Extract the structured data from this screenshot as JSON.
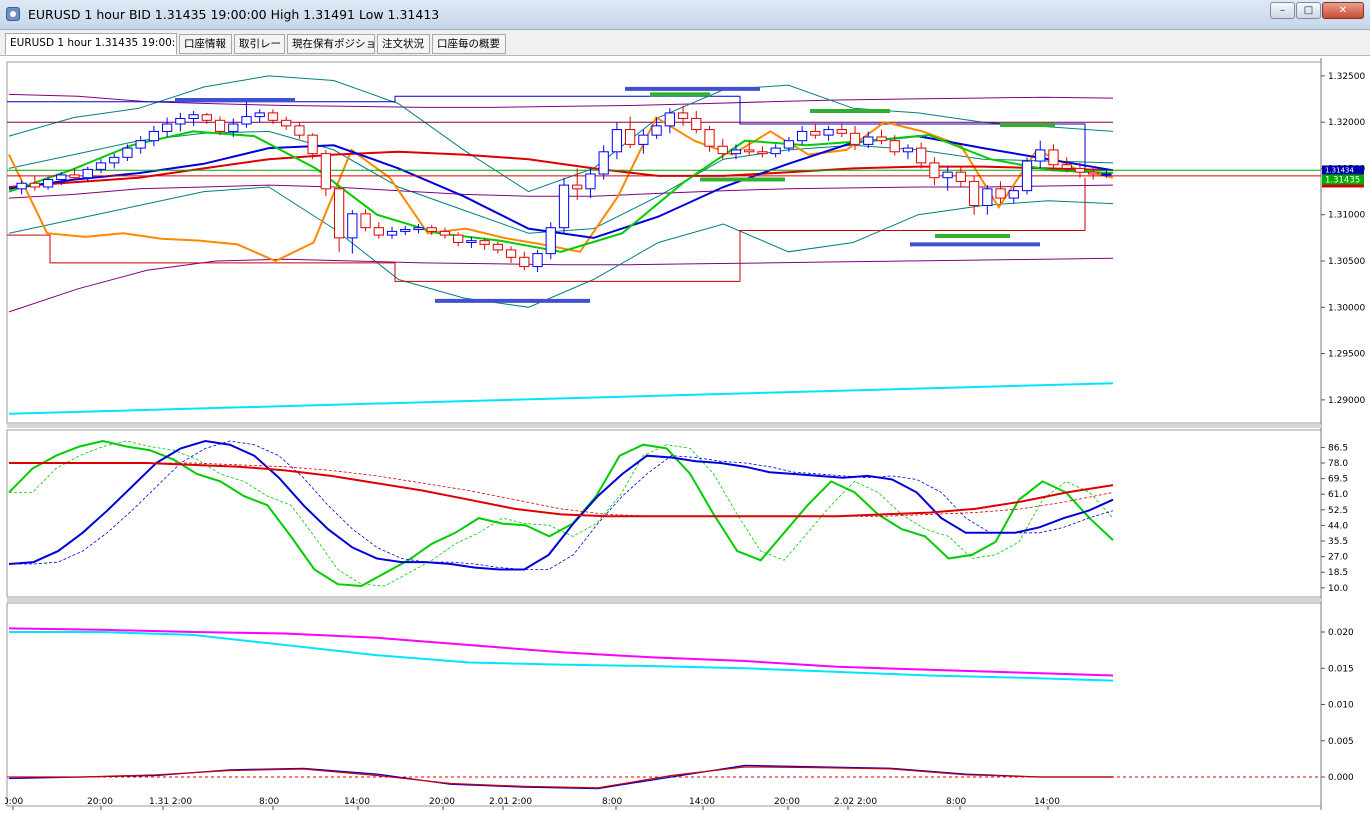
{
  "window": {
    "title": "EURUSD 1 hour BID 1.31435 19:00:00 High 1.31491 Low 1.31413",
    "buttons": {
      "minimize": "–",
      "maximize": "□",
      "close": "✕"
    }
  },
  "tabs": [
    {
      "label": "EURUSD 1 hour 1.31435 19:00:00",
      "active": true
    },
    {
      "label": "口座情報"
    },
    {
      "label": "取引レート"
    },
    {
      "label": "現在保有ポジション"
    },
    {
      "label": "注文状況"
    },
    {
      "label": "口座毎の概要"
    }
  ],
  "colors": {
    "background": "#ffffff",
    "candle_up": "#0000ff",
    "candle_down": "#e00000",
    "ma_fast": "#00cc00",
    "ma_mid": "#0000dd",
    "ma_slow": "#dd0000",
    "orange": "#ff8800",
    "cyan": "#00e5ff",
    "magenta": "#ff00ff",
    "teal": "#008080",
    "purple": "#800080"
  },
  "price_labels": {
    "current": "1.31435",
    "current_small": "1.31434"
  },
  "chart_data": [
    {
      "type": "candlestick",
      "panel": "price",
      "symbol": "EURUSD",
      "timeframe": "1 hour",
      "y_ticks": [
        1.325,
        1.32,
        1.315,
        1.31,
        1.305,
        1.3,
        1.295,
        1.29
      ],
      "y_tick_labels": [
        "1.32500",
        "1.32000",
        "1.31500",
        "1.31000",
        "1.30500",
        "1.30000",
        "1.29500",
        "1.29000"
      ],
      "ylim": [
        1.2875,
        1.3265
      ],
      "x_tick_labels": [
        "0:00",
        "20:00",
        "1.31  2:00",
        "8:00",
        "14:00",
        "20:00",
        "2.01  2:00",
        "8:00",
        "14:00",
        "20:00",
        "2.02  2:00",
        "8:00",
        "14:00"
      ],
      "current_price": 1.31435,
      "high": 1.31491,
      "low": 1.31413,
      "candles": [
        [
          1.3128,
          1.3137,
          1.3122,
          1.3134
        ],
        [
          1.3134,
          1.3142,
          1.3126,
          1.313
        ],
        [
          1.313,
          1.3141,
          1.3127,
          1.3138
        ],
        [
          1.3138,
          1.3146,
          1.3132,
          1.3143
        ],
        [
          1.3143,
          1.315,
          1.3138,
          1.314
        ],
        [
          1.314,
          1.3152,
          1.3136,
          1.3149
        ],
        [
          1.3149,
          1.316,
          1.3145,
          1.3156
        ],
        [
          1.3156,
          1.3166,
          1.315,
          1.3162
        ],
        [
          1.3162,
          1.3176,
          1.3158,
          1.3172
        ],
        [
          1.3172,
          1.3185,
          1.3166,
          1.318
        ],
        [
          1.318,
          1.3196,
          1.3174,
          1.319
        ],
        [
          1.319,
          1.3205,
          1.3184,
          1.3198
        ],
        [
          1.3198,
          1.321,
          1.319,
          1.3204
        ],
        [
          1.3204,
          1.3212,
          1.3196,
          1.3208
        ],
        [
          1.3208,
          1.321,
          1.3198,
          1.3202
        ],
        [
          1.3202,
          1.3206,
          1.3186,
          1.319
        ],
        [
          1.319,
          1.3204,
          1.3184,
          1.3198
        ],
        [
          1.3198,
          1.3222,
          1.3194,
          1.3206
        ],
        [
          1.3206,
          1.3214,
          1.32,
          1.321
        ],
        [
          1.321,
          1.3214,
          1.3198,
          1.3202
        ],
        [
          1.3202,
          1.3206,
          1.3192,
          1.3196
        ],
        [
          1.3196,
          1.32,
          1.3182,
          1.3186
        ],
        [
          1.3186,
          1.3188,
          1.316,
          1.3166
        ],
        [
          1.3166,
          1.317,
          1.312,
          1.3128
        ],
        [
          1.3128,
          1.313,
          1.306,
          1.3075
        ],
        [
          1.3075,
          1.3105,
          1.3058,
          1.3101
        ],
        [
          1.3101,
          1.3106,
          1.3082,
          1.3086
        ],
        [
          1.3086,
          1.3092,
          1.3074,
          1.3078
        ],
        [
          1.3078,
          1.3087,
          1.3074,
          1.3082
        ],
        [
          1.3082,
          1.3088,
          1.3078,
          1.3084
        ],
        [
          1.3084,
          1.309,
          1.308,
          1.3086
        ],
        [
          1.3086,
          1.3089,
          1.3078,
          1.3082
        ],
        [
          1.3082,
          1.3086,
          1.3074,
          1.3078
        ],
        [
          1.3078,
          1.3081,
          1.3066,
          1.307
        ],
        [
          1.307,
          1.3076,
          1.3064,
          1.3072
        ],
        [
          1.3072,
          1.3075,
          1.3062,
          1.3068
        ],
        [
          1.3068,
          1.3071,
          1.3058,
          1.3062
        ],
        [
          1.3062,
          1.3066,
          1.3048,
          1.3054
        ],
        [
          1.3054,
          1.306,
          1.304,
          1.3044
        ],
        [
          1.3044,
          1.3062,
          1.3038,
          1.3058
        ],
        [
          1.3058,
          1.3092,
          1.3052,
          1.3086
        ],
        [
          1.3086,
          1.314,
          1.308,
          1.3132
        ],
        [
          1.3132,
          1.315,
          1.3116,
          1.3128
        ],
        [
          1.3128,
          1.315,
          1.3118,
          1.3144
        ],
        [
          1.3144,
          1.3175,
          1.3138,
          1.3168
        ],
        [
          1.3168,
          1.32,
          1.316,
          1.3192
        ],
        [
          1.3192,
          1.3206,
          1.3172,
          1.3176
        ],
        [
          1.3176,
          1.3192,
          1.3166,
          1.3186
        ],
        [
          1.3186,
          1.3205,
          1.3182,
          1.3196
        ],
        [
          1.3196,
          1.3215,
          1.3188,
          1.321
        ],
        [
          1.321,
          1.3218,
          1.3196,
          1.3204
        ],
        [
          1.3204,
          1.3212,
          1.3188,
          1.3192
        ],
        [
          1.3192,
          1.3196,
          1.3168,
          1.3174
        ],
        [
          1.3174,
          1.3182,
          1.316,
          1.3166
        ],
        [
          1.3166,
          1.3176,
          1.316,
          1.317
        ],
        [
          1.317,
          1.3179,
          1.3164,
          1.3168
        ],
        [
          1.3168,
          1.3174,
          1.3162,
          1.3166
        ],
        [
          1.3166,
          1.3176,
          1.3162,
          1.3172
        ],
        [
          1.3172,
          1.3184,
          1.3168,
          1.318
        ],
        [
          1.318,
          1.3196,
          1.3176,
          1.319
        ],
        [
          1.319,
          1.3198,
          1.3182,
          1.3186
        ],
        [
          1.3186,
          1.3196,
          1.318,
          1.3192
        ],
        [
          1.3192,
          1.3198,
          1.3184,
          1.3188
        ],
        [
          1.3188,
          1.3196,
          1.317,
          1.3176
        ],
        [
          1.3176,
          1.319,
          1.3172,
          1.3184
        ],
        [
          1.3184,
          1.3192,
          1.3176,
          1.318
        ],
        [
          1.318,
          1.3186,
          1.3164,
          1.3168
        ],
        [
          1.3168,
          1.3176,
          1.316,
          1.3172
        ],
        [
          1.3172,
          1.3178,
          1.315,
          1.3156
        ],
        [
          1.3156,
          1.3162,
          1.3132,
          1.314
        ],
        [
          1.314,
          1.3152,
          1.3126,
          1.3146
        ],
        [
          1.3146,
          1.3152,
          1.313,
          1.3136
        ],
        [
          1.3136,
          1.3142,
          1.31,
          1.311
        ],
        [
          1.311,
          1.3132,
          1.31,
          1.3128
        ],
        [
          1.3128,
          1.3136,
          1.3112,
          1.3118
        ],
        [
          1.3118,
          1.313,
          1.3112,
          1.3126
        ],
        [
          1.3126,
          1.3162,
          1.3122,
          1.3158
        ],
        [
          1.3158,
          1.318,
          1.315,
          1.317
        ],
        [
          1.317,
          1.3176,
          1.315,
          1.3154
        ],
        [
          1.3154,
          1.3162,
          1.3146,
          1.315
        ],
        [
          1.315,
          1.3156,
          1.314,
          1.3146
        ],
        [
          1.3146,
          1.3152,
          1.3138,
          1.3144
        ],
        [
          1.3144,
          1.315,
          1.314,
          1.3144
        ]
      ]
    },
    {
      "type": "line",
      "panel": "oscillator",
      "y_ticks": [
        10.0,
        18.5,
        27.0,
        35.5,
        44.0,
        52.5,
        61.0,
        69.5,
        78.0,
        86.5
      ],
      "y_tick_labels": [
        "10.0",
        "18.5",
        "27.0",
        "35.5",
        "44.0",
        "52.5",
        "61.0",
        "69.5",
        "78.0",
        "86.5"
      ],
      "ylim": [
        5,
        96
      ],
      "series": [
        {
          "color": "green",
          "values": [
            62,
            75,
            82,
            87,
            90,
            87,
            85,
            80,
            72,
            68,
            60,
            55,
            38,
            20,
            12,
            11,
            18,
            25,
            34,
            40,
            48,
            45,
            44,
            38,
            45,
            60,
            82,
            88,
            86,
            72,
            50,
            30,
            25,
            40,
            55,
            68,
            62,
            50,
            42,
            38,
            26,
            28,
            35,
            58,
            68,
            62,
            48,
            36
          ]
        },
        {
          "color": "blue",
          "values": [
            23,
            24,
            30,
            40,
            52,
            65,
            78,
            86,
            90,
            88,
            82,
            70,
            55,
            42,
            32,
            26,
            24,
            24,
            23,
            21,
            20,
            20,
            28,
            45,
            60,
            72,
            82,
            81,
            79,
            78,
            76,
            73,
            72,
            71,
            70,
            71,
            69,
            62,
            48,
            40,
            40,
            40,
            43,
            48,
            52,
            58
          ]
        },
        {
          "color": "red",
          "values": [
            78,
            78,
            78,
            78,
            77,
            76,
            74,
            71,
            67,
            63,
            58,
            53,
            50,
            49,
            49,
            49,
            49,
            49,
            49,
            50,
            51,
            53,
            57,
            62,
            66
          ]
        }
      ]
    },
    {
      "type": "line",
      "panel": "lower",
      "y_ticks": [
        0.0,
        0.005,
        0.01,
        0.015,
        0.02
      ],
      "y_tick_labels": [
        "0.000",
        "0.005",
        "0.010",
        "0.015",
        "0.020"
      ],
      "ylim": [
        -0.004,
        0.024
      ],
      "series": [
        {
          "color": "magenta",
          "values": [
            0.0205,
            0.0203,
            0.02,
            0.0198,
            0.0192,
            0.0182,
            0.0172,
            0.0165,
            0.016,
            0.0152,
            0.0148,
            0.0144,
            0.014
          ]
        },
        {
          "color": "cyan",
          "values": [
            0.02,
            0.02,
            0.0196,
            0.0182,
            0.0168,
            0.0158,
            0.0155,
            0.0153,
            0.015,
            0.0145,
            0.014,
            0.0137,
            0.0133
          ]
        }
      ]
    }
  ]
}
